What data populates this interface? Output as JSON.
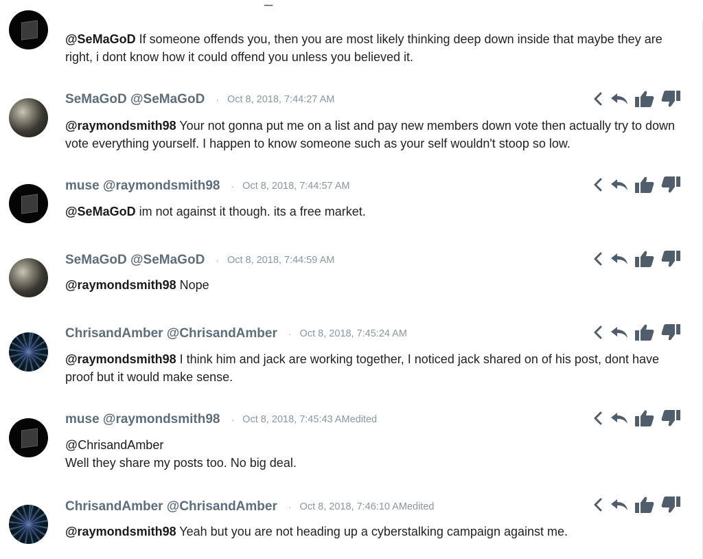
{
  "page": {
    "top_partial_title": "_"
  },
  "comments": [
    {
      "author": "",
      "avatar_icon": "muse-cube-avatar",
      "mention": "@SeMaGoD",
      "text": " If someone offends you, then you are most likely thinking deep down inside that maybe they are right, i dont know how it could offend you unless you believed it.",
      "time": "",
      "edited": ""
    },
    {
      "author": "SeMaGoD @SeMaGoD",
      "avatar_icon": "semagod-avatar",
      "separator": "·",
      "time": "Oct 8, 2018, 7:44:27 AM",
      "edited": "",
      "mention": "@raymondsmith98",
      "text": " Your not gonna put me on a list and pay new members down vote then actually try to down vote everything yourself. I happen to know someone such as your self wouldn't stoop so low."
    },
    {
      "author": "muse @raymondsmith98",
      "avatar_icon": "muse-cube-avatar",
      "separator": "·",
      "time": "Oct 8, 2018, 7:44:57 AM",
      "edited": "",
      "mention": "@SeMaGoD",
      "text": " im not against it though. its a free market."
    },
    {
      "author": "SeMaGoD @SeMaGoD",
      "avatar_icon": "semagod-avatar",
      "separator": "·",
      "time": "Oct 8, 2018, 7:44:59 AM",
      "edited": "",
      "mention": "@raymondsmith98",
      "text": " Nope"
    },
    {
      "author": "ChrisandAmber @ChrisandAmber",
      "avatar_icon": "chrisandamber-avatar",
      "separator": "·",
      "time": "Oct 8, 2018, 7:45:24 AM",
      "edited": "",
      "mention": "@raymondsmith98",
      "text": " I think him and jack are working together, I noticed jack shared on of his post, dont have proof but it would make sense."
    },
    {
      "author": "muse @raymondsmith98",
      "avatar_icon": "muse-cube-avatar",
      "separator": "·",
      "time": "Oct 8, 2018, 7:45:43 AM",
      "edited": "edited",
      "mention_line": "@ChrisandAmber",
      "text_line": "Well they share my posts too. No big deal."
    },
    {
      "author": "ChrisandAmber @ChrisandAmber",
      "avatar_icon": "chrisandamber-avatar",
      "separator": "·",
      "time": "Oct 8, 2018, 7:46:10 AM",
      "edited": "edited",
      "mention": "@raymondsmith98",
      "text": " Yeah but you are not heading up a cyberstalking campaign against me."
    }
  ],
  "action_icons": [
    "chevron-left-icon",
    "reply-icon",
    "thumbs-up-icon",
    "thumbs-down-icon"
  ],
  "colors": {
    "author": "#5d6d7a",
    "timestamp": "#8a96a0",
    "icon": "#4f5e6a",
    "text": "#222222"
  }
}
